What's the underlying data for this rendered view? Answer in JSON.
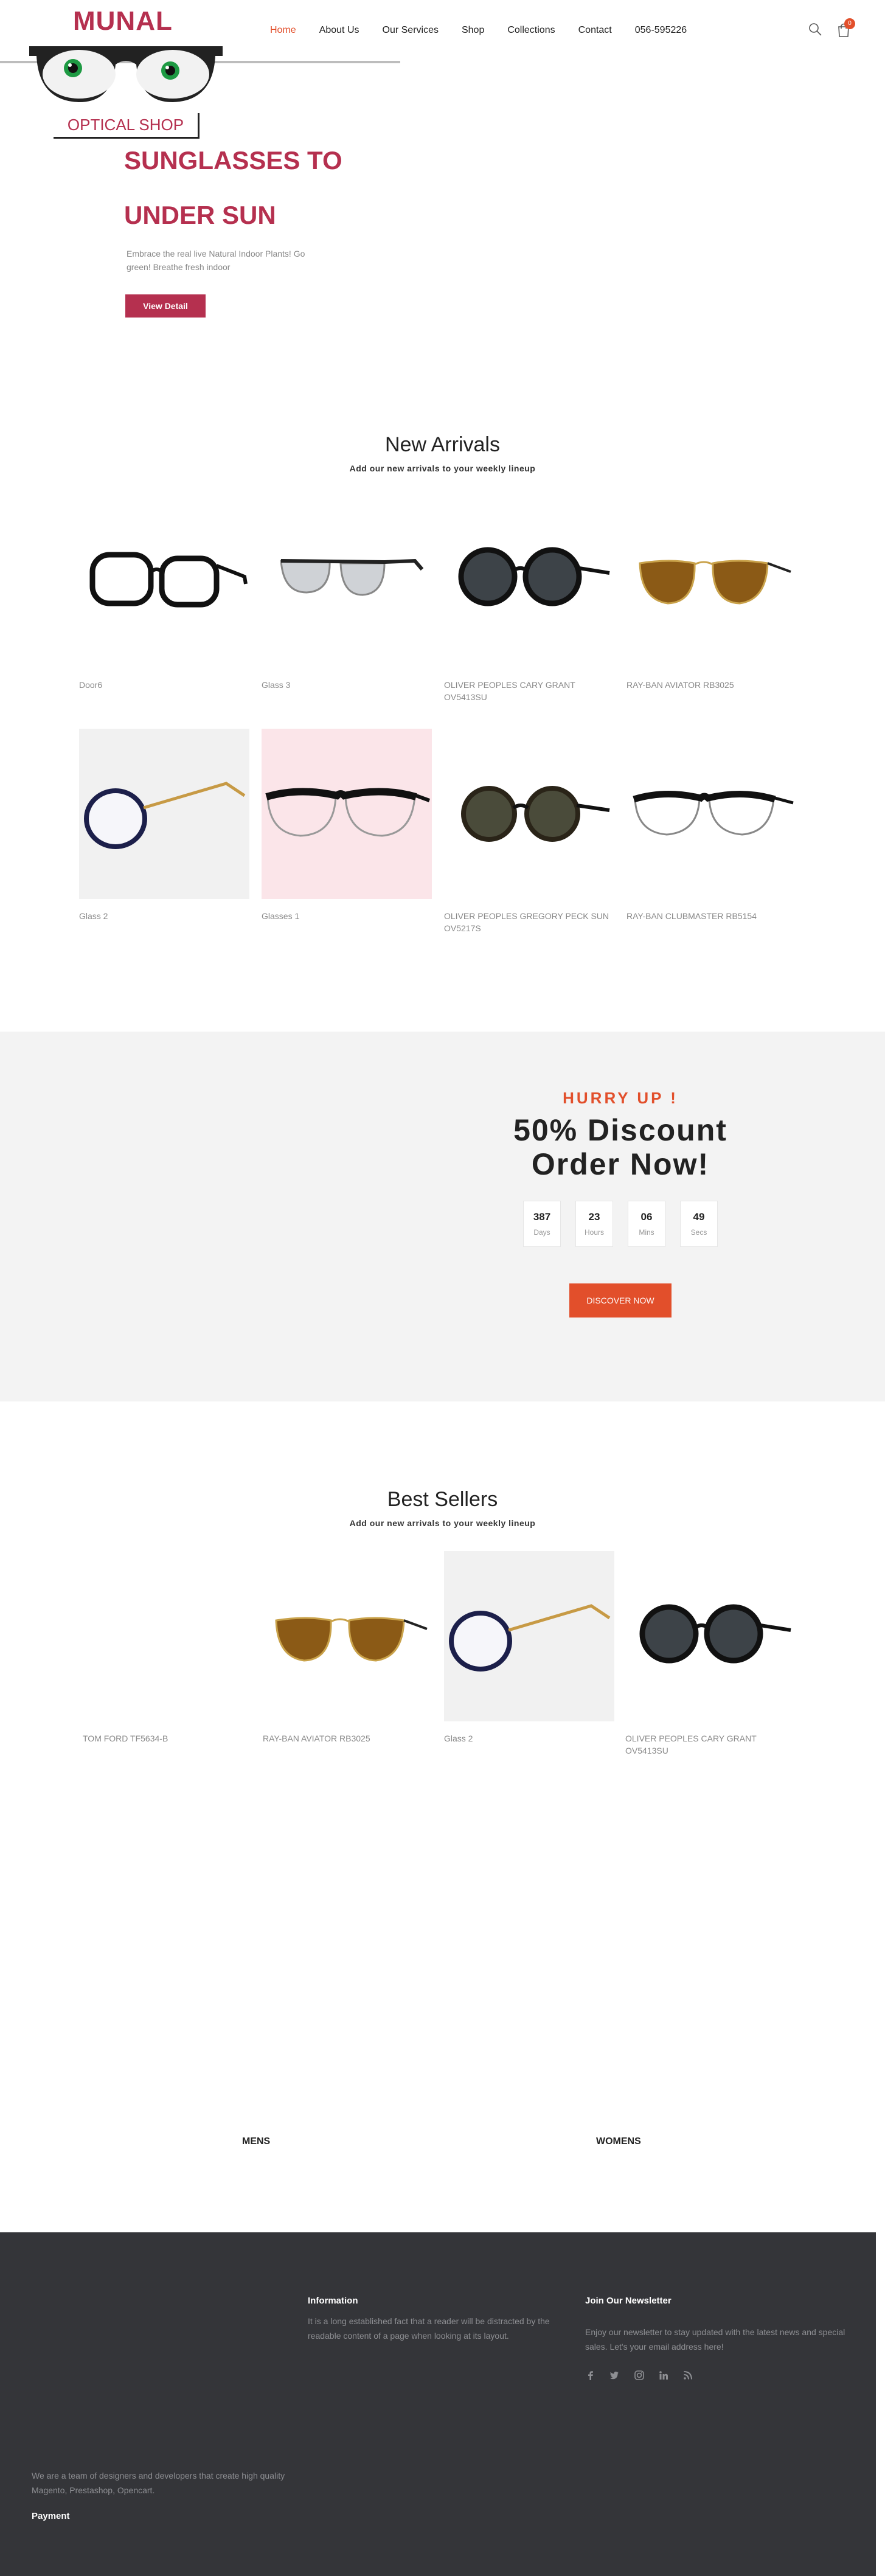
{
  "brand": {
    "name": "MUNAL",
    "tagline": "OPTICAL SHOP",
    "accent": "#b5304f"
  },
  "nav": {
    "items": [
      "Home",
      "About Us",
      "Our Services",
      "Shop",
      "Collections",
      "Contact",
      "056-595226"
    ],
    "active_index": 0,
    "cart_count": "0"
  },
  "hero": {
    "title_line1": "SUNGLASSES TO",
    "title_line2": "UNDER SUN",
    "description": "Embrace the real live Natural Indoor Plants! Go green! Breathe fresh indoor",
    "button": "View Detail"
  },
  "new_arrivals": {
    "title": "New Arrivals",
    "subtitle": "Add our new arrivals to your weekly lineup",
    "products": [
      {
        "name": "Door6"
      },
      {
        "name": "Glass 3"
      },
      {
        "name": "OLIVER PEOPLES CARY GRANT OV5413SU"
      },
      {
        "name": "RAY-BAN AVIATOR RB3025"
      },
      {
        "name": "Glass 2"
      },
      {
        "name": "Glasses 1"
      },
      {
        "name": "OLIVER PEOPLES GREGORY PECK SUN OV5217S"
      },
      {
        "name": "RAY-BAN CLUBMASTER RB5154"
      }
    ]
  },
  "discount": {
    "hurry": "HURRY UP !",
    "title_line1": "50% Discount",
    "title_line2": "Order Now!",
    "countdown": [
      {
        "value": "387",
        "label": "Days"
      },
      {
        "value": "23",
        "label": "Hours"
      },
      {
        "value": "06",
        "label": "Mins"
      },
      {
        "value": "49",
        "label": "Secs"
      }
    ],
    "button": "DISCOVER NOW",
    "accent": "#e24f2b"
  },
  "best_sellers": {
    "title": "Best Sellers",
    "subtitle": "Add our new arrivals to your weekly lineup",
    "products": [
      {
        "name": "TOM FORD TF5634-B"
      },
      {
        "name": "RAY-BAN AVIATOR RB3025"
      },
      {
        "name": "Glass 2"
      },
      {
        "name": "OLIVER PEOPLES CARY GRANT OV5413SU"
      }
    ]
  },
  "categories": [
    "MENS",
    "WOMENS"
  ],
  "footer": {
    "about": "We are a team of designers and developers that create high quality Magento, Prestashop, Opencart.",
    "payment": "Payment",
    "information_title": "Information",
    "information_text": "It is a long established fact that a reader will be distracted by the readable content of a page when looking at its layout.",
    "newsletter_title": "Join Our Newsletter",
    "newsletter_text": "Enjoy our newsletter to stay updated with the latest news and special sales. Let's your email address here!",
    "social_icons": [
      "facebook-icon",
      "twitter-icon",
      "instagram-icon",
      "linkedin-icon",
      "rss-icon"
    ]
  }
}
